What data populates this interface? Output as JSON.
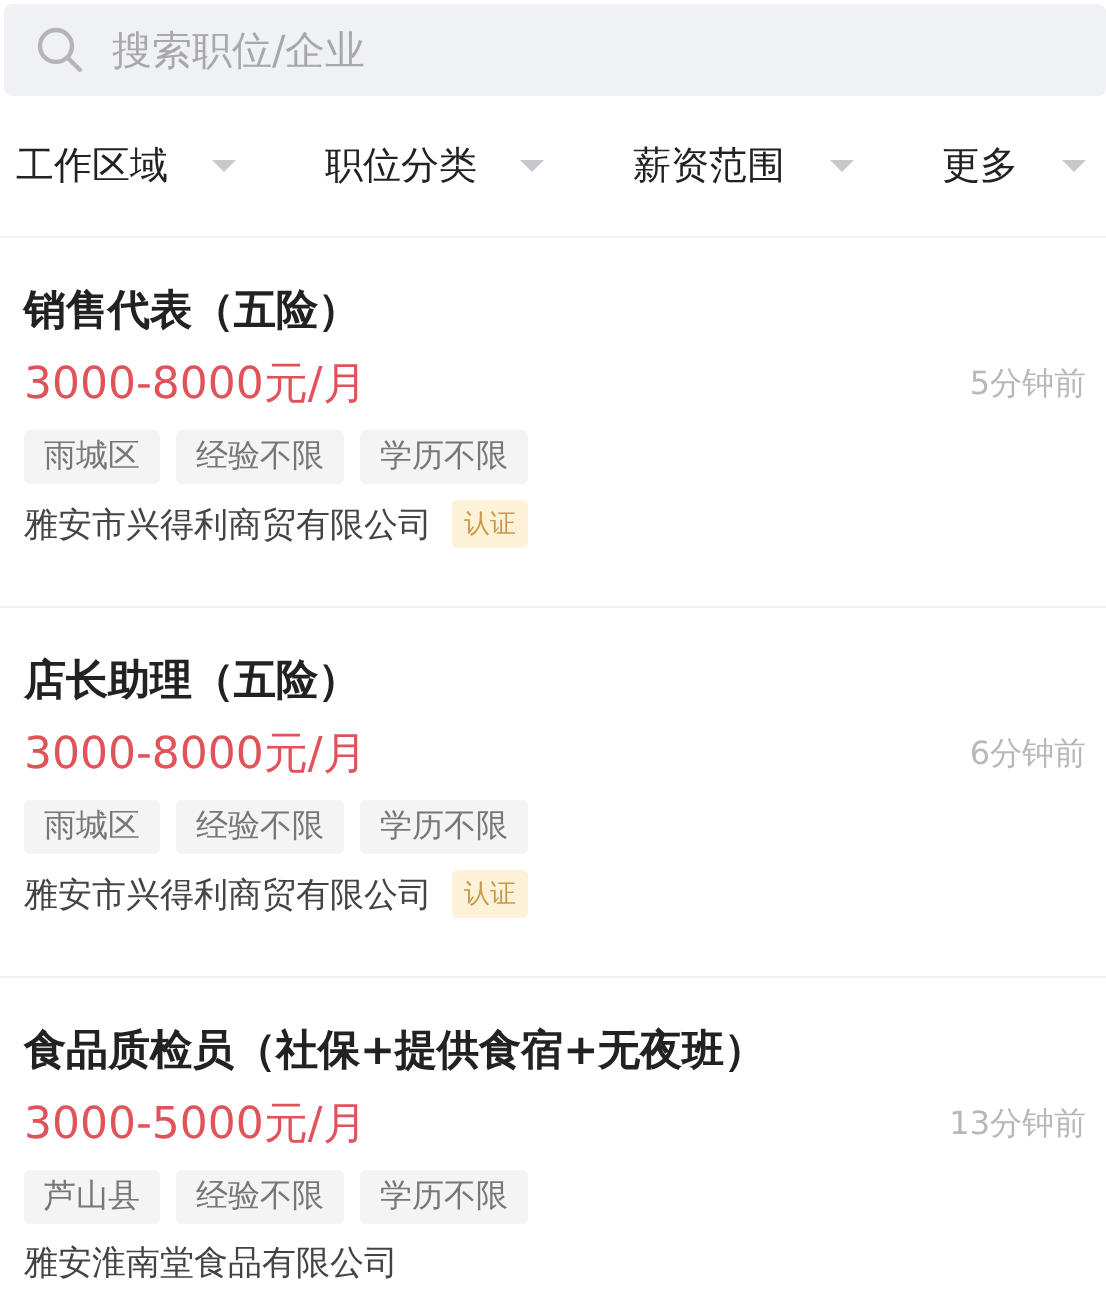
{
  "search": {
    "placeholder": "搜索职位/企业"
  },
  "filters": [
    {
      "label": "工作区域"
    },
    {
      "label": "职位分类"
    },
    {
      "label": "薪资范围"
    },
    {
      "label": "更多"
    }
  ],
  "jobs": [
    {
      "title": "销售代表（五险）",
      "salary": "3000-8000元/月",
      "time": "5分钟前",
      "tags": [
        "雨城区",
        "经验不限",
        "学历不限"
      ],
      "company": "雅安市兴得利商贸有限公司",
      "badge": "认证"
    },
    {
      "title": "店长助理（五险）",
      "salary": "3000-8000元/月",
      "time": "6分钟前",
      "tags": [
        "雨城区",
        "经验不限",
        "学历不限"
      ],
      "company": "雅安市兴得利商贸有限公司",
      "badge": "认证"
    },
    {
      "title": "食品质检员（社保+提供食宿+无夜班）",
      "salary": "3000-5000元/月",
      "time": "13分钟前",
      "tags": [
        "芦山县",
        "经验不限",
        "学历不限"
      ],
      "company": "雅安淮南堂食品有限公司"
    }
  ]
}
